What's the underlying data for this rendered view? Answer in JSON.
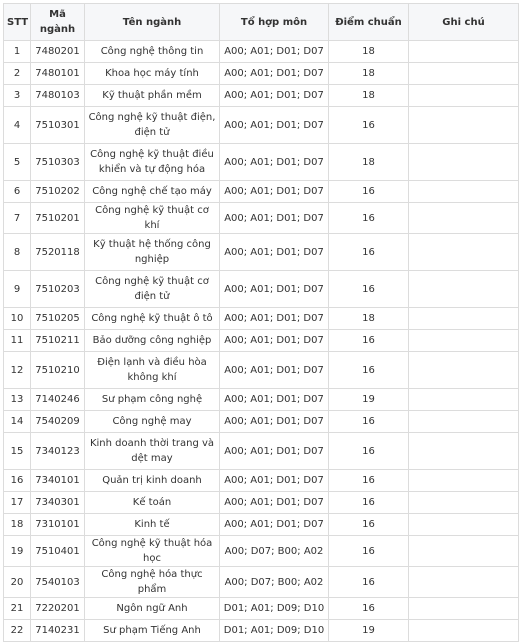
{
  "headers": [
    "STT",
    "Mã ngành",
    "Tên ngành",
    "Tổ hợp môn",
    "Điểm chuẩn",
    "Ghi chú"
  ],
  "rows": [
    {
      "stt": "1",
      "code": "7480201",
      "name": "Công nghệ thông tin",
      "combo": "A00; A01; D01; D07",
      "score": "18",
      "note": ""
    },
    {
      "stt": "2",
      "code": "7480101",
      "name": "Khoa học máy tính",
      "combo": "A00; A01; D01; D07",
      "score": "18",
      "note": ""
    },
    {
      "stt": "3",
      "code": "7480103",
      "name": "Kỹ thuật phần mềm",
      "combo": "A00; A01; D01; D07",
      "score": "18",
      "note": ""
    },
    {
      "stt": "4",
      "code": "7510301",
      "name": "Công nghệ kỹ thuật điện, điện tử",
      "combo": "A00; A01; D01; D07",
      "score": "16",
      "note": ""
    },
    {
      "stt": "5",
      "code": "7510303",
      "name": "Công nghệ kỹ thuật điều khiển và tự động hóa",
      "combo": "A00; A01; D01; D07",
      "score": "18",
      "note": ""
    },
    {
      "stt": "6",
      "code": "7510202",
      "name": "Công nghệ chế tạo máy",
      "combo": "A00; A01; D01; D07",
      "score": "16",
      "note": ""
    },
    {
      "stt": "7",
      "code": "7510201",
      "name": "Công nghệ kỹ thuật cơ khí",
      "combo": "A00; A01; D01; D07",
      "score": "16",
      "note": ""
    },
    {
      "stt": "8",
      "code": "7520118",
      "name": "Kỹ thuật hệ thống công nghiệp",
      "combo": "A00; A01; D01; D07",
      "score": "16",
      "note": ""
    },
    {
      "stt": "9",
      "code": "7510203",
      "name": "Công nghệ kỹ thuật cơ điện tử",
      "combo": "A00; A01; D01; D07",
      "score": "16",
      "note": ""
    },
    {
      "stt": "10",
      "code": "7510205",
      "name": "Công nghệ kỹ thuật ô tô",
      "combo": "A00; A01; D01; D07",
      "score": "18",
      "note": ""
    },
    {
      "stt": "11",
      "code": "7510211",
      "name": "Bảo dưỡng công nghiệp",
      "combo": "A00; A01; D01; D07",
      "score": "16",
      "note": ""
    },
    {
      "stt": "12",
      "code": "7510210",
      "name": "Điện lạnh và điều hòa không khí",
      "combo": "A00; A01; D01; D07",
      "score": "16",
      "note": ""
    },
    {
      "stt": "13",
      "code": "7140246",
      "name": "Sư phạm công nghệ",
      "combo": "A00; A01; D01; D07",
      "score": "19",
      "note": ""
    },
    {
      "stt": "14",
      "code": "7540209",
      "name": "Công nghệ may",
      "combo": "A00; A01; D01; D07",
      "score": "16",
      "note": ""
    },
    {
      "stt": "15",
      "code": "7340123",
      "name": "Kinh doanh thời trang và dệt may",
      "combo": "A00; A01; D01; D07",
      "score": "16",
      "note": ""
    },
    {
      "stt": "16",
      "code": "7340101",
      "name": "Quản trị kinh doanh",
      "combo": "A00; A01; D01; D07",
      "score": "16",
      "note": ""
    },
    {
      "stt": "17",
      "code": "7340301",
      "name": "Kế toán",
      "combo": "A00; A01; D01; D07",
      "score": "16",
      "note": ""
    },
    {
      "stt": "18",
      "code": "7310101",
      "name": "Kinh tế",
      "combo": "A00; A01; D01; D07",
      "score": "16",
      "note": ""
    },
    {
      "stt": "19",
      "code": "7510401",
      "name": "Công nghệ kỹ thuật hóa học",
      "combo": "A00; D07; B00; A02",
      "score": "16",
      "note": ""
    },
    {
      "stt": "20",
      "code": "7540103",
      "name": "Công nghệ hóa thực phẩm",
      "combo": "A00; D07; B00; A02",
      "score": "16",
      "note": ""
    },
    {
      "stt": "21",
      "code": "7220201",
      "name": "Ngôn ngữ Anh",
      "combo": "D01; A01; D09; D10",
      "score": "16",
      "note": ""
    },
    {
      "stt": "22",
      "code": "7140231",
      "name": "Sư phạm Tiếng Anh",
      "combo": "D01; A01; D09; D10",
      "score": "19",
      "note": ""
    }
  ]
}
